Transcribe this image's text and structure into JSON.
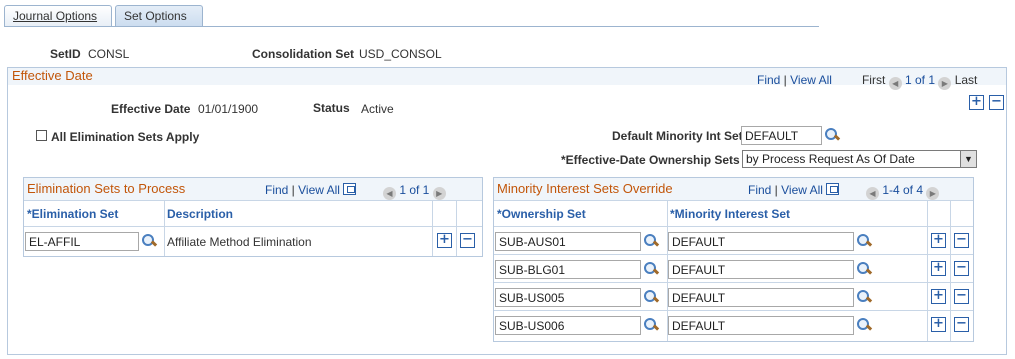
{
  "tabs": [
    {
      "label": "Journal Options",
      "active": false
    },
    {
      "label": "Set Options",
      "active": true
    }
  ],
  "header": {
    "setid_label": "SetID",
    "setid_value": "CONSL",
    "consol_label": "Consolidation Set",
    "consol_value": "USD_CONSOL"
  },
  "effective_date_section": {
    "title": "Effective Date",
    "find": "Find",
    "view_all": "View All",
    "first": "First",
    "page_count": "1 of 1",
    "last": "Last",
    "eff_date_label": "Effective Date",
    "eff_date_value": "01/01/1900",
    "status_label": "Status",
    "status_value": "Active",
    "all_elim_label": "All Elimination Sets Apply",
    "default_minority_label": "Default Minority Int Set",
    "default_minority_value": "DEFAULT",
    "ownership_label": "*Effective-Date Ownership Sets",
    "ownership_value": "by Process Request As Of Date"
  },
  "elim_grid": {
    "title": "Elimination Sets to Process",
    "find": "Find",
    "view_all": "View All",
    "page_count": "1 of 1",
    "col_set": "*Elimination Set",
    "col_desc": "Description",
    "rows": [
      {
        "set": "EL-AFFIL",
        "description": "Affiliate Method Elimination"
      }
    ]
  },
  "minority_grid": {
    "title": "Minority Interest Sets Override",
    "find": "Find",
    "view_all": "View All",
    "page_count": "1-4 of 4",
    "col_owner": "*Ownership Set",
    "col_minority": "*Minority Interest Set",
    "rows": [
      {
        "owner": "SUB-AUS01",
        "minority": "DEFAULT"
      },
      {
        "owner": "SUB-BLG01",
        "minority": "DEFAULT"
      },
      {
        "owner": "SUB-US005",
        "minority": "DEFAULT"
      },
      {
        "owner": "SUB-US006",
        "minority": "DEFAULT"
      }
    ]
  },
  "icons": {
    "add": "+",
    "remove": "−",
    "prev": "◀",
    "next": "▶",
    "dropdown": "▼"
  }
}
